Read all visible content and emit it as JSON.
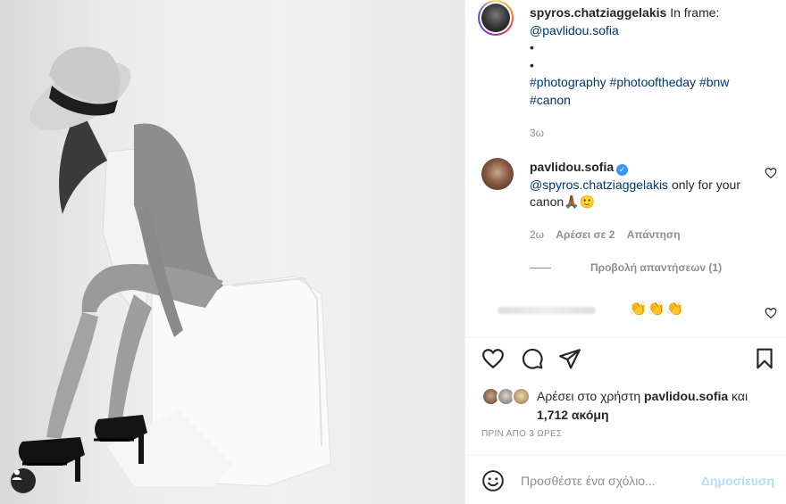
{
  "post": {
    "author": "spyros.chatziaggelakis",
    "caption_text": "In frame:",
    "mention": "@pavlidou.sofia",
    "bullets": [
      "•",
      "•"
    ],
    "hashtags": [
      "#photography",
      "#photooftheday",
      "#bnw",
      "#canon"
    ],
    "age": "3ω"
  },
  "comments": [
    {
      "user": "pavlidou.sofia",
      "mention": "@spyros.chatziaggelakis",
      "text": "only for your canon🙏🏾🙂",
      "age": "2ω",
      "likes": "Αρέσει σε 2",
      "reply": "Απάντηση",
      "view_replies": "Προβολή απαντήσεων (1)"
    },
    {
      "text": "👏👏👏"
    }
  ],
  "likes": {
    "prefix": "Αρέσει στο χρήστη",
    "user": "pavlidou.sofia",
    "conj": "και",
    "count": "1,712 ακόμη"
  },
  "timestamp": "ΠΡΙΝ ΑΠΟ 3 ΩΡΕΣ",
  "composer": {
    "placeholder": "Προσθέστε ένα σχόλιο...",
    "post_label": "Δημοσίευση"
  },
  "colors": {
    "link": "#00376b",
    "verified": "#3897f0",
    "post_button": "#b2dffc"
  }
}
